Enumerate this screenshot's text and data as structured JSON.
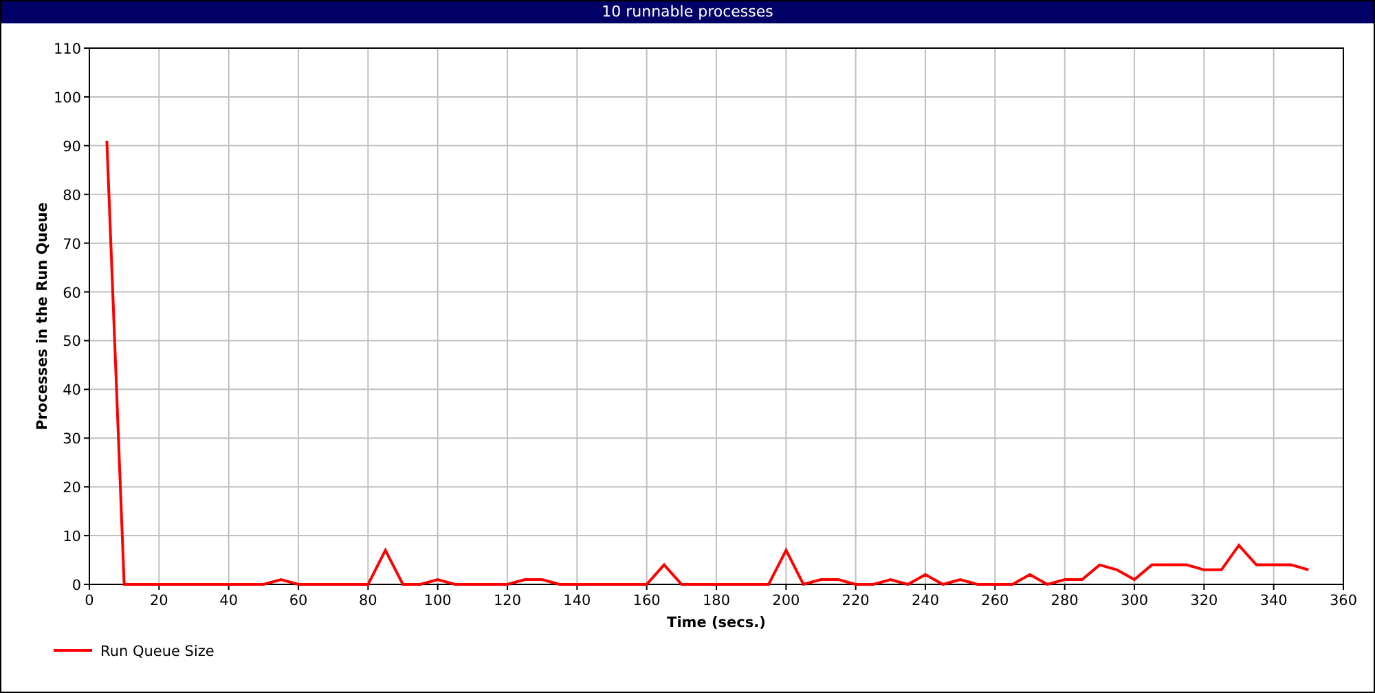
{
  "window": {
    "title": "10 runnable processes"
  },
  "chart": {
    "chart_data": {
      "type": "line",
      "grid": true,
      "xlabel": "Time (secs.)",
      "ylabel": "Processes in the Run Queue",
      "xlim": [
        0,
        360
      ],
      "ylim": [
        0,
        110
      ],
      "xticks": [
        0,
        20,
        40,
        60,
        80,
        100,
        120,
        140,
        160,
        180,
        200,
        220,
        240,
        260,
        280,
        300,
        320,
        340,
        360
      ],
      "yticks": [
        0,
        10,
        20,
        30,
        40,
        50,
        60,
        70,
        80,
        90,
        100,
        110
      ],
      "x": [
        5,
        10,
        15,
        20,
        25,
        30,
        35,
        40,
        45,
        50,
        55,
        60,
        65,
        70,
        75,
        80,
        85,
        90,
        95,
        100,
        105,
        110,
        115,
        120,
        125,
        130,
        135,
        140,
        145,
        150,
        155,
        160,
        165,
        170,
        175,
        180,
        185,
        190,
        195,
        200,
        205,
        210,
        215,
        220,
        225,
        230,
        235,
        240,
        245,
        250,
        255,
        260,
        265,
        270,
        275,
        280,
        285,
        290,
        295,
        300,
        305,
        310,
        315,
        320,
        325,
        330,
        335,
        340,
        345,
        350
      ],
      "series": [
        {
          "name": "Run Queue Size",
          "color": "#ff0000",
          "values": [
            91,
            0,
            0,
            0,
            0,
            0,
            0,
            0,
            0,
            0,
            1,
            0,
            0,
            0,
            0,
            0,
            7,
            0,
            0,
            1,
            0,
            0,
            0,
            0,
            1,
            1,
            0,
            0,
            0,
            0,
            0,
            0,
            4,
            0,
            0,
            0,
            0,
            0,
            0,
            7,
            0,
            1,
            1,
            0,
            0,
            1,
            0,
            2,
            0,
            1,
            0,
            0,
            0,
            2,
            0,
            1,
            1,
            4,
            3,
            1,
            4,
            4,
            4,
            3,
            3,
            8,
            4,
            4,
            4,
            3
          ]
        }
      ]
    }
  }
}
